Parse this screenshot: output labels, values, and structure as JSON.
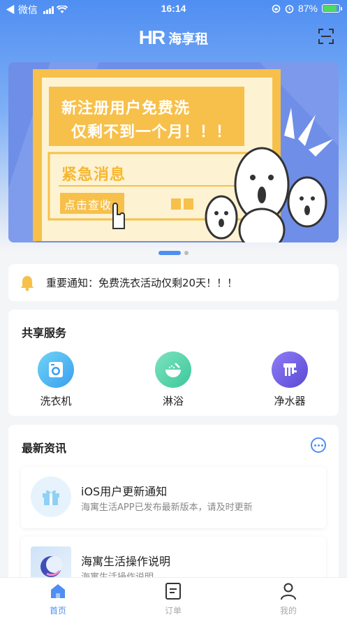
{
  "status_bar": {
    "carrier": "◀ 微信",
    "time": "16:14",
    "battery_pct": "87%",
    "battery_level": 0.87
  },
  "header": {
    "logo_mark": "HR",
    "logo_text": "海享租",
    "scan_icon": "scan-icon"
  },
  "banner": {
    "headline_1": "新注册用户免费洗",
    "headline_2": "仅剩不到一个月！！！",
    "urgent_title": "紧急消息",
    "cta_label": "点击查收",
    "colors": {
      "bg": "#6f8ee8",
      "yellow": "#f7c04a"
    }
  },
  "notice": {
    "icon": "bell-icon",
    "text": "重要通知：免费洗衣活动仅剩20天！！！"
  },
  "services": {
    "title": "共享服务",
    "items": [
      {
        "label": "洗衣机",
        "icon": "washing-machine-icon"
      },
      {
        "label": "淋浴",
        "icon": "shower-icon"
      },
      {
        "label": "净水器",
        "icon": "water-purifier-icon"
      }
    ]
  },
  "news": {
    "title": "最新资讯",
    "more_icon": "more-icon",
    "items": [
      {
        "title": "iOS用户更新通知",
        "subtitle": "海寓生活APP已发布最新版本，请及时更新",
        "icon": "gift-icon"
      },
      {
        "title": "海寓生活操作说明",
        "subtitle": "海寓生活操作说明",
        "icon": "app-logo-icon"
      }
    ]
  },
  "tabbar": {
    "items": [
      {
        "label": "首页",
        "icon": "home-icon",
        "active": true
      },
      {
        "label": "订单",
        "icon": "order-icon",
        "active": false
      },
      {
        "label": "我的",
        "icon": "user-icon",
        "active": false
      }
    ],
    "active_color": "#4f8ef2"
  }
}
